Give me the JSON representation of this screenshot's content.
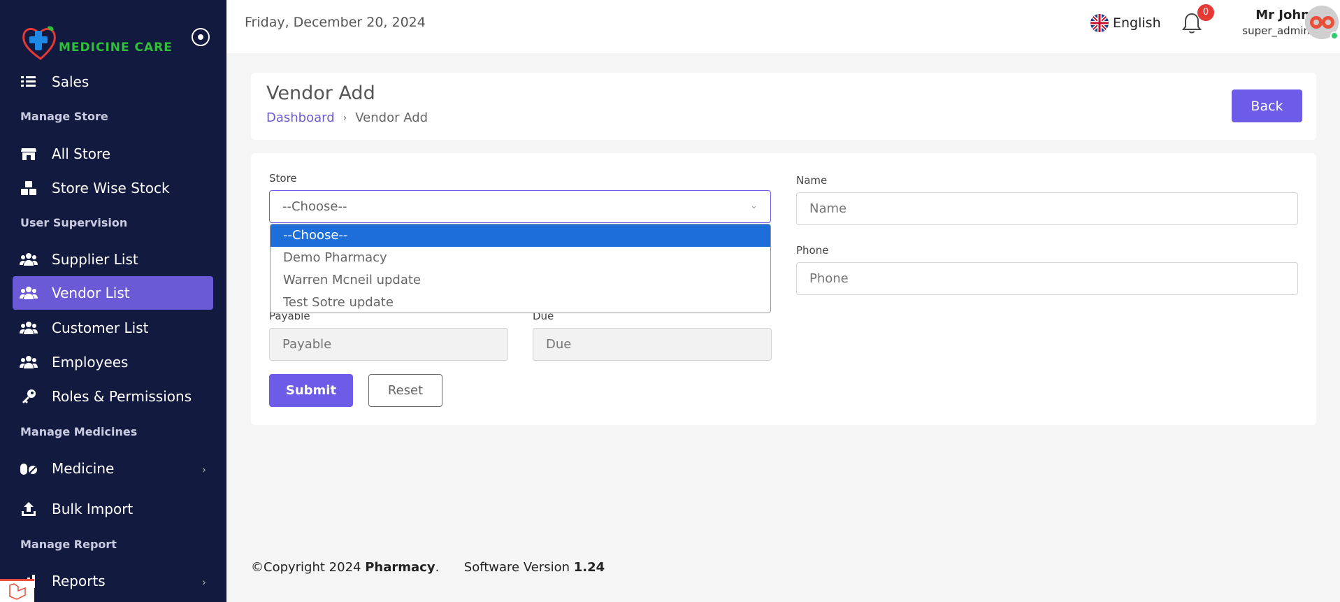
{
  "brand": {
    "name": "MEDICINE CARE"
  },
  "sidebar": {
    "items": [
      {
        "label": "Sales",
        "icon": "list-icon"
      },
      {
        "section": "Manage Store"
      },
      {
        "label": "All Store",
        "icon": "store-icon"
      },
      {
        "label": "Store Wise Stock",
        "icon": "boxes-icon"
      },
      {
        "section": "User Supervision"
      },
      {
        "label": "Supplier List",
        "icon": "users-icon"
      },
      {
        "label": "Vendor List",
        "icon": "users-icon",
        "active": true
      },
      {
        "label": "Customer List",
        "icon": "users-icon"
      },
      {
        "label": "Employees",
        "icon": "users-icon"
      },
      {
        "label": "Roles & Permissions",
        "icon": "key-icon"
      },
      {
        "section": "Manage Medicines"
      },
      {
        "label": "Medicine",
        "icon": "pills-icon",
        "has_children": true
      },
      {
        "label": "Bulk Import",
        "icon": "upload-icon"
      },
      {
        "section": "Manage Report"
      },
      {
        "label": "Reports",
        "icon": "chart-icon",
        "has_children": true
      }
    ]
  },
  "topbar": {
    "date": "Friday, December 20, 2024",
    "language": "English",
    "notification_count": "0",
    "user_name": "Mr John",
    "user_role": "super_admin"
  },
  "header": {
    "title": "Vendor Add",
    "breadcrumb_home": "Dashboard",
    "breadcrumb_current": "Vendor Add",
    "back_label": "Back"
  },
  "form": {
    "store_label": "Store",
    "store_value": "--Choose--",
    "store_options": [
      "--Choose--",
      "Demo Pharmacy",
      "Warren Mcneil update",
      "Test Sotre update"
    ],
    "name_label": "Name",
    "name_placeholder": "Name",
    "phone_label": "Phone",
    "phone_placeholder": "Phone",
    "payable_label": "Payable",
    "payable_placeholder": "Payable",
    "due_label": "Due",
    "due_placeholder": "Due",
    "submit_label": "Submit",
    "reset_label": "Reset"
  },
  "footer": {
    "copyright": "©Copyright 2024 ",
    "company": "Pharmacy",
    "version_label": "Software Version ",
    "version": "1.24"
  },
  "colors": {
    "sidebar_bg": "#131a3f",
    "accent": "#6c5ce7",
    "select_highlight": "#1d6ed8",
    "badge": "#e53935",
    "online": "#2ecc71"
  }
}
